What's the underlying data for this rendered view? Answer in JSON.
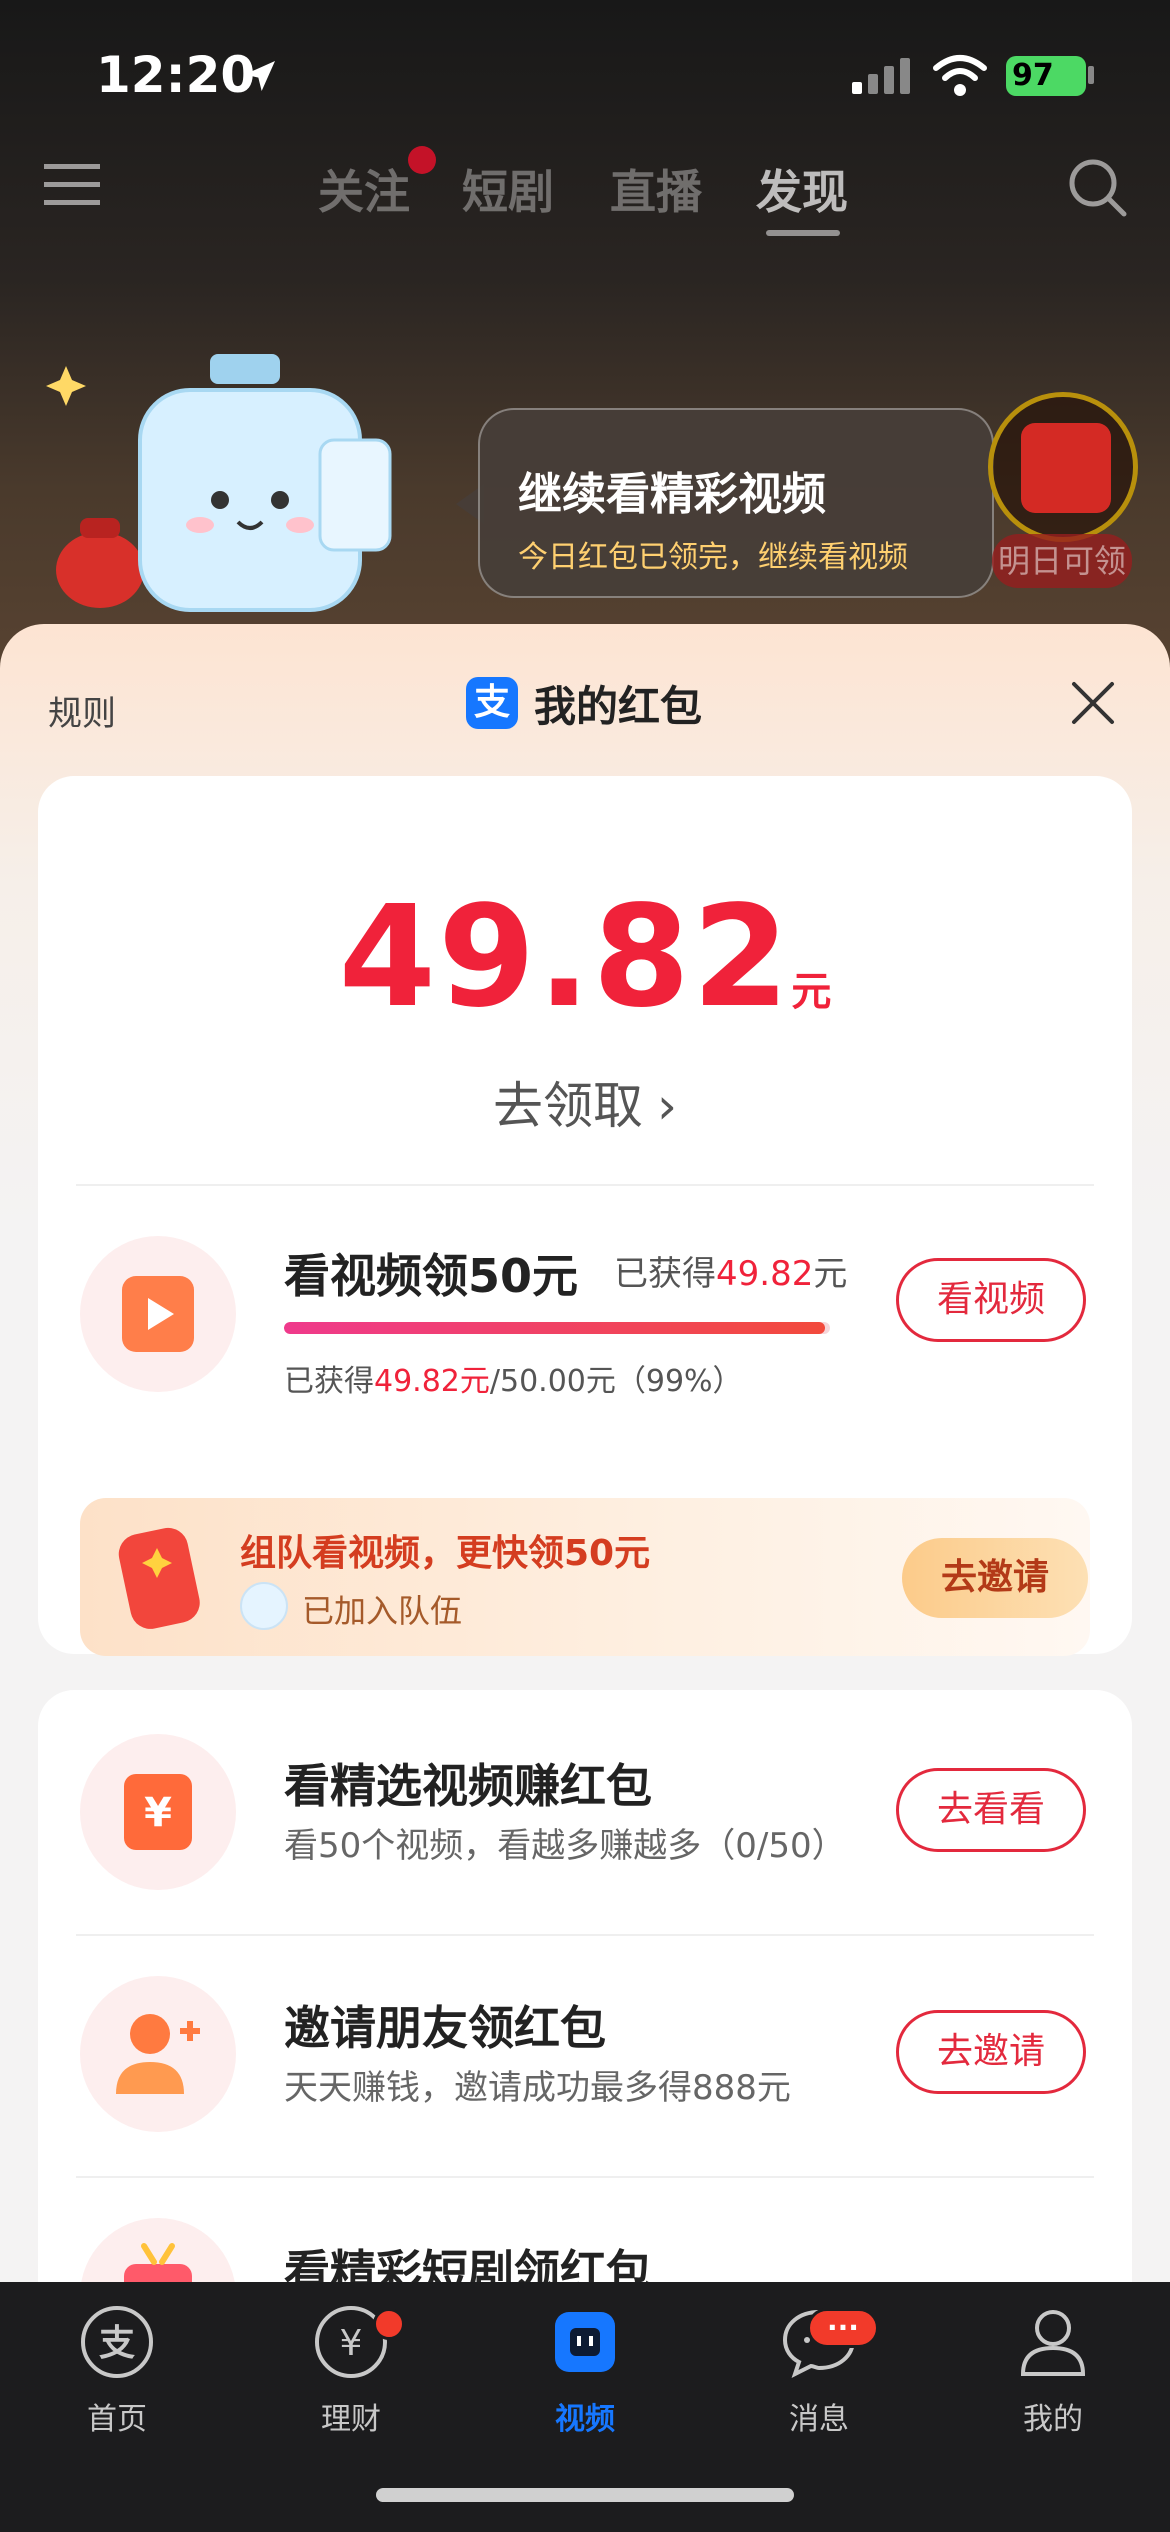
{
  "status_bar": {
    "time": "12:20",
    "battery": "97"
  },
  "top_nav": {
    "tabs": [
      "关注",
      "短剧",
      "直播",
      "发现"
    ]
  },
  "overlay": {
    "bubble_title": "继续看精彩视频",
    "bubble_subtitle": "今日红包已领完，继续看视频",
    "coin_label": "明日可领"
  },
  "sheet": {
    "rules_label": "规则",
    "logo_glyph": "支",
    "title": "我的红包",
    "amount": "49.82",
    "amount_unit": "元",
    "claim_label": "去领取"
  },
  "video_task": {
    "title": "看视频领50元",
    "earned_prefix": "已获得",
    "earned_amount": "49.82",
    "earned_suffix": "元",
    "button": "看视频",
    "progress": 0.99,
    "progress_prefix": "已获得",
    "progress_amount": "49.82元",
    "progress_suffix": "/50.00元（99%）"
  },
  "team_banner": {
    "title": "组队看视频，更快领50元",
    "status": "已加入队伍",
    "button": "去邀请"
  },
  "tasks": [
    {
      "title": "看精选视频赚红包",
      "subtitle": "看50个视频，看越多赚越多（0/50）",
      "button": "去看看"
    },
    {
      "title": "邀请朋友领红包",
      "subtitle": "天天赚钱，邀请成功最多得888元",
      "button": "去邀请"
    },
    {
      "title": "看精彩短剧领红包",
      "subtitle": "",
      "button": ""
    }
  ],
  "tab_bar": {
    "items": [
      "首页",
      "理财",
      "视频",
      "消息",
      "我的"
    ],
    "message_badge": "···"
  },
  "colors": {
    "accent_red": "#f0223a",
    "alipay_blue": "#1677ff"
  }
}
